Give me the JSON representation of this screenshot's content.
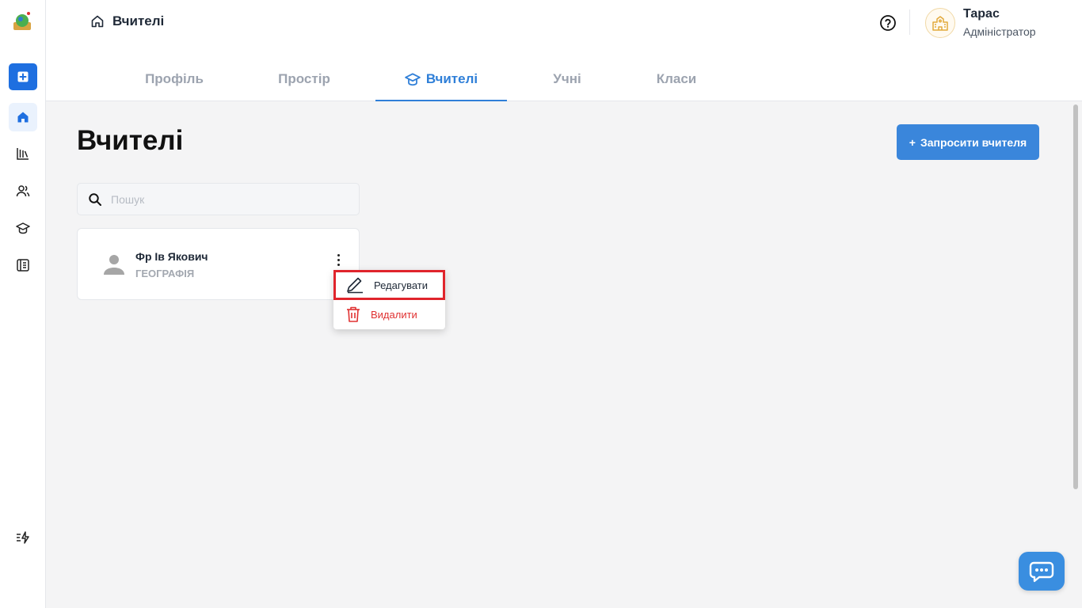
{
  "header": {
    "breadcrumb": "Вчителі",
    "user": {
      "name": "Тарас",
      "role": "Адміністратор"
    }
  },
  "tabs": [
    {
      "label": "Профіль",
      "active": false
    },
    {
      "label": "Простір",
      "active": false
    },
    {
      "label": "Вчителі",
      "active": true
    },
    {
      "label": "Учні",
      "active": false
    },
    {
      "label": "Класи",
      "active": false
    }
  ],
  "main": {
    "title": "Вчителі",
    "invite_button": "Запросити вчителя",
    "search": {
      "value": "",
      "placeholder": "Пошук"
    },
    "teachers": [
      {
        "name": "Фр Ів Якович",
        "subject": "ГЕОГРАФІЯ"
      }
    ]
  },
  "context_menu": {
    "edit": "Редагувати",
    "delete": "Видалити"
  },
  "colors": {
    "primary": "#3a86db",
    "danger": "#e03131",
    "highlight_border": "#e0242c"
  }
}
